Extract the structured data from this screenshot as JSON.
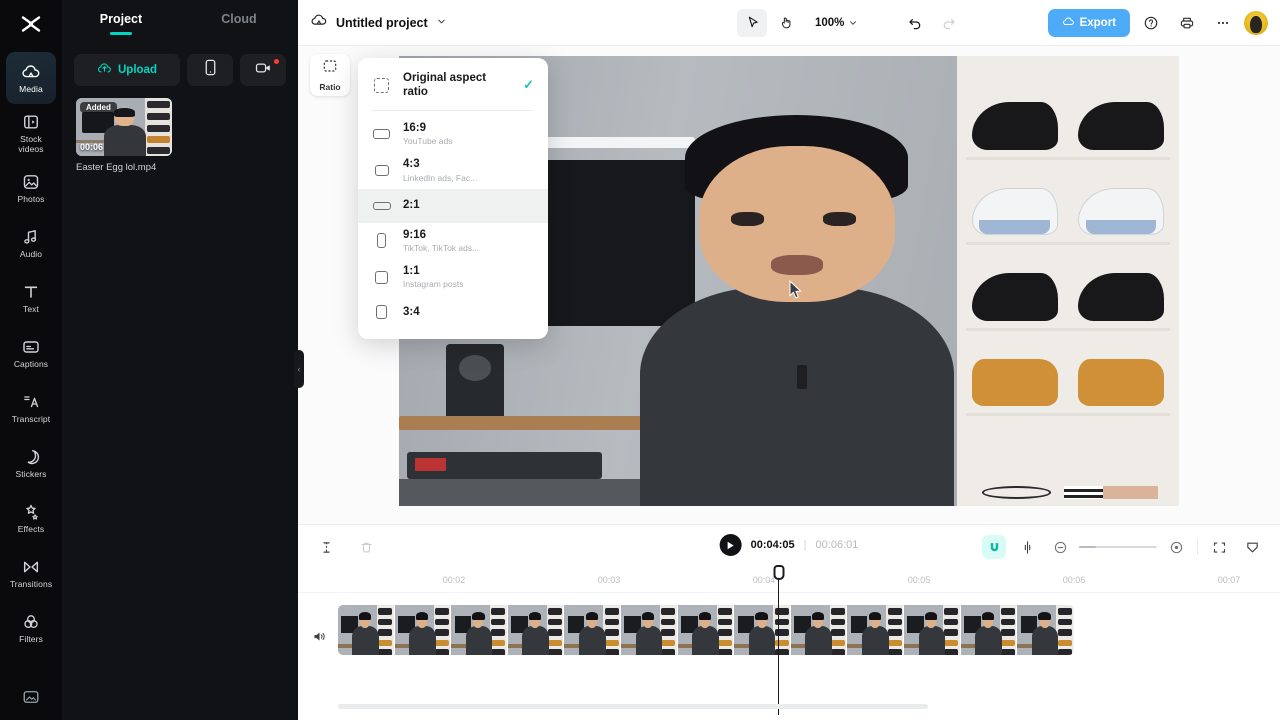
{
  "rail": {
    "logo_icon": "capcut-logo-icon",
    "items": [
      {
        "label": "Media",
        "icon": "media-cloud-icon",
        "active": true
      },
      {
        "label": "Stock videos",
        "icon": "stock-videos-icon",
        "active": false
      },
      {
        "label": "Photos",
        "icon": "photos-icon",
        "active": false
      },
      {
        "label": "Audio",
        "icon": "audio-note-icon",
        "active": false
      },
      {
        "label": "Text",
        "icon": "text-t-icon",
        "active": false
      },
      {
        "label": "Captions",
        "icon": "captions-icon",
        "active": false
      },
      {
        "label": "Transcript",
        "icon": "transcript-icon",
        "active": false
      },
      {
        "label": "Stickers",
        "icon": "stickers-icon",
        "active": false
      },
      {
        "label": "Effects",
        "icon": "effects-icon",
        "active": false
      },
      {
        "label": "Transitions",
        "icon": "transitions-icon",
        "active": false
      },
      {
        "label": "Filters",
        "icon": "filters-icon",
        "active": false
      }
    ],
    "bottom_icon": "gallery-icon"
  },
  "panel": {
    "tabs": [
      {
        "label": "Project",
        "active": true
      },
      {
        "label": "Cloud",
        "active": false
      }
    ],
    "upload_label": "Upload",
    "upload_icon": "upload-cloud-icon",
    "device_icon": "phone-icon",
    "record_icon": "record-camera-icon",
    "media": [
      {
        "name": "Easter Egg lol.mp4",
        "badge": "Added",
        "duration": "00:06"
      }
    ]
  },
  "topbar": {
    "cloud_icon": "cloud-icon",
    "project_title": "Untitled project",
    "project_chevron": "chevron-down-icon",
    "select_tool_icon": "cursor-arrow-icon",
    "hand_tool_icon": "hand-icon",
    "zoom_level": "100%",
    "zoom_chevron": "chevron-down-icon",
    "undo_icon": "undo-icon",
    "redo_icon": "redo-icon",
    "export_label": "Export",
    "export_icon": "export-cloud-icon",
    "export_color": "#4dabf7",
    "help_icon": "help-circle-icon",
    "print_icon": "printer-icon",
    "more_icon": "more-horizontal-icon",
    "avatar_icon": "avatar"
  },
  "editor": {
    "ratio_button_label": "Ratio",
    "ratio_button_icon": "ratio-dashed-icon"
  },
  "ratio_menu": {
    "accent_color": "#15c6b0",
    "items": [
      {
        "title": "Original aspect ratio",
        "sub": "",
        "icon": "dashed-square-icon",
        "checked": true,
        "highlighted": false
      },
      {
        "title": "16:9",
        "sub": "YouTube ads",
        "icon": "rect-wide-icon",
        "checked": false,
        "highlighted": false
      },
      {
        "title": "4:3",
        "sub": "LinkedIn ads, Fac...",
        "icon": "rect-43-icon",
        "checked": false,
        "highlighted": false
      },
      {
        "title": "2:1",
        "sub": "",
        "icon": "rect-ultrawide-icon",
        "checked": false,
        "highlighted": true
      },
      {
        "title": "9:16",
        "sub": "TikTok, TikTok ads...",
        "icon": "rect-portrait-icon",
        "checked": false,
        "highlighted": false
      },
      {
        "title": "1:1",
        "sub": "Instagram posts",
        "icon": "rect-square-icon",
        "checked": false,
        "highlighted": false
      },
      {
        "title": "3:4",
        "sub": "",
        "icon": "rect-34-icon",
        "checked": false,
        "highlighted": false
      }
    ]
  },
  "timeline": {
    "split_icon": "split-icon",
    "delete_icon": "trash-icon",
    "play_icon": "play-icon",
    "current_time": "00:04:05",
    "separator": "|",
    "total_time": "00:06:01",
    "magnet_icon": "magnet-icon",
    "keyframe_icon": "keyframe-icon",
    "zoom_out_icon": "zoom-out-icon",
    "zoom_in_icon": "zoom-in-icon",
    "fit_icon": "fit-screen-icon",
    "marker_icon": "marker-icon",
    "mute_icon": "speaker-icon",
    "ruler_ticks": [
      "00:02",
      "00:03",
      "00:04",
      "00:05",
      "00:06",
      "00:07"
    ],
    "clip_frame_count": 13
  }
}
